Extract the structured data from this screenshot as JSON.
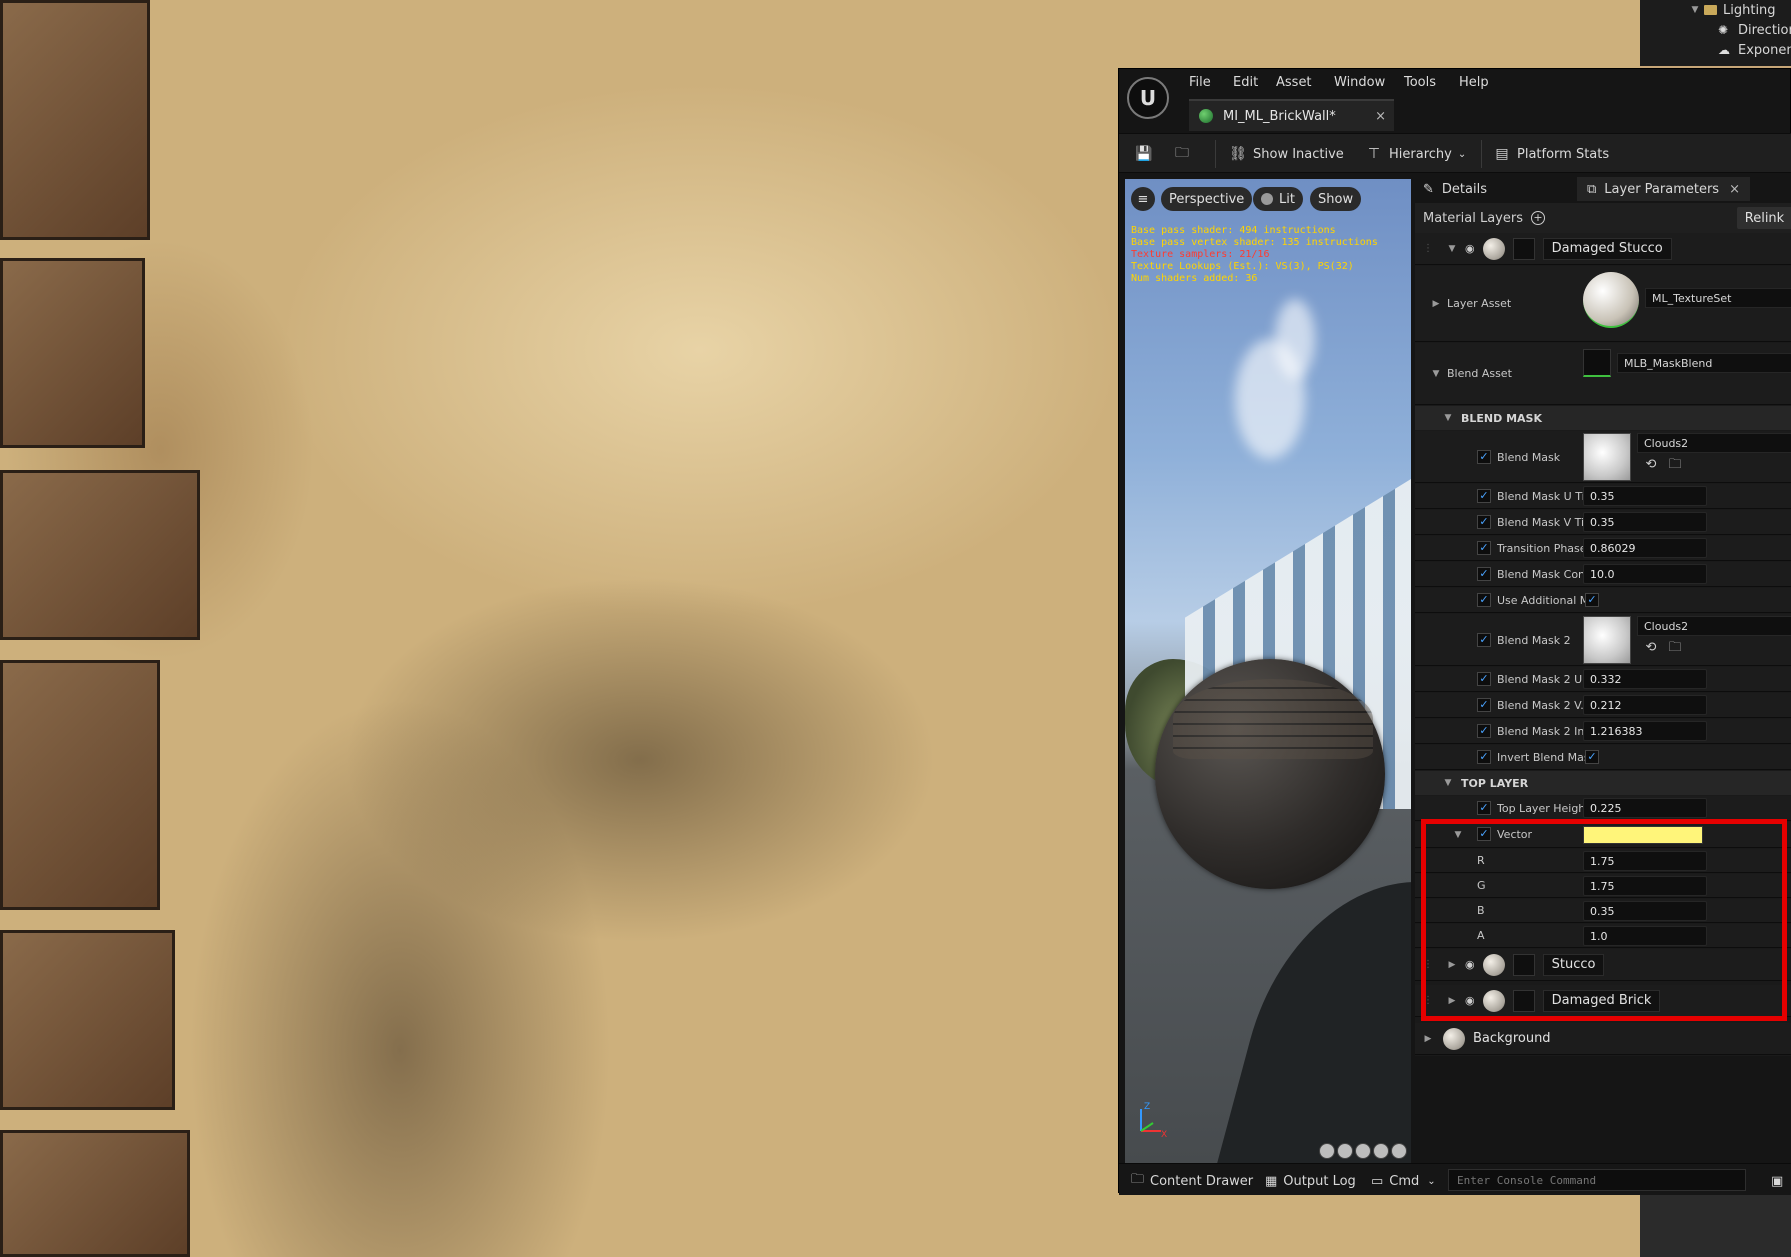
{
  "outliner": {
    "items": [
      {
        "label": "Lighting",
        "icon": "folder-icon"
      },
      {
        "label": "Direction",
        "icon": "directional-light-icon"
      },
      {
        "label": "Exponen",
        "icon": "exponential-fog-icon"
      }
    ]
  },
  "menu": {
    "items": [
      "File",
      "Edit",
      "Asset",
      "Window",
      "Tools",
      "Help"
    ]
  },
  "document_tab": {
    "title": "MI_ML_BrickWall*",
    "close": "×"
  },
  "toolbar": {
    "show_inactive": "Show Inactive",
    "hierarchy": "Hierarchy",
    "platform_stats": "Platform Stats"
  },
  "viewport": {
    "perspective": "Perspective",
    "lit": "Lit",
    "show": "Show",
    "stats": [
      {
        "text": "Base pass shader: 494 instructions",
        "color": "#ffd400"
      },
      {
        "text": "Base pass vertex shader: 135 instructions",
        "color": "#ffd400"
      },
      {
        "text": "Texture samplers: 21/16",
        "color": "#ff3b2f"
      },
      {
        "text": "Texture Lookups (Est.): VS(3), PS(32)",
        "color": "#ffd400"
      },
      {
        "text": "Num shaders added: 36",
        "color": "#ffd400"
      }
    ],
    "axis_z": "Z",
    "axis_x": "X"
  },
  "panel": {
    "tabs": {
      "details": "Details",
      "layer_parameters": "Layer Parameters",
      "close": "×"
    },
    "material_layers_label": "Material Layers",
    "relink_label": "Relink",
    "layers": {
      "damaged_stucco": "Damaged Stucco",
      "stucco": "Stucco",
      "damaged_brick": "Damaged Brick",
      "background": "Background"
    },
    "layer_asset": {
      "label": "Layer Asset",
      "value": "ML_TextureSet"
    },
    "blend_asset": {
      "label": "Blend Asset",
      "value": "MLB_MaskBlend"
    },
    "blend_mask_section": "BLEND MASK",
    "blend_mask_params": [
      {
        "label": "Blend Mask",
        "texture": "Clouds2"
      },
      {
        "label": "Blend Mask U Tili...",
        "value": "0.35"
      },
      {
        "label": "Blend Mask V Tili...",
        "value": "0.35"
      },
      {
        "label": "Transition Phase",
        "value": "0.86029"
      },
      {
        "label": "Blend Mask Cont...",
        "value": "10.0"
      },
      {
        "label": "Use Additional M..."
      },
      {
        "label": "Blend Mask 2",
        "texture": "Clouds2"
      },
      {
        "label": "Blend Mask 2 U...",
        "value": "0.332"
      },
      {
        "label": "Blend Mask 2 V...",
        "value": "0.212"
      },
      {
        "label": "Blend Mask 2 Int...",
        "value": "1.216383"
      },
      {
        "label": "Invert Blend Mask"
      }
    ],
    "top_layer_section": "TOP LAYER",
    "top_layer_params": {
      "height": {
        "label": "Top  Layer Heigh...",
        "value": "0.225"
      },
      "vector": {
        "label": "Vector",
        "color": "#fff57a"
      },
      "channels": [
        {
          "label": "R",
          "value": "1.75"
        },
        {
          "label": "G",
          "value": "1.75"
        },
        {
          "label": "B",
          "value": "0.35"
        },
        {
          "label": "A",
          "value": "1.0"
        }
      ]
    }
  },
  "bottom_bar": {
    "content_drawer": "Content Drawer",
    "output_log": "Output Log",
    "cmd": "Cmd",
    "console_placeholder": "Enter Console Command"
  },
  "colors": {
    "accent_checkbox": "#4aa3ff",
    "highlight": "#e60000",
    "vector_swatch": "#fff57a"
  }
}
